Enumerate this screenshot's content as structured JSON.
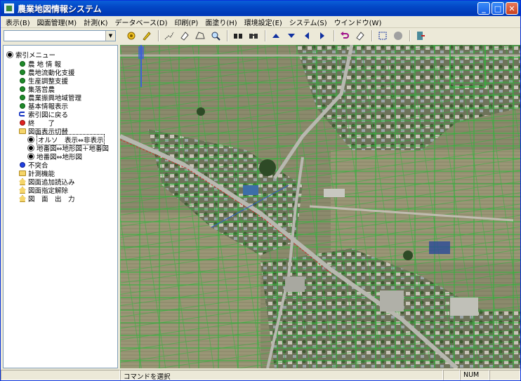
{
  "window": {
    "title": "農業地図情報システム"
  },
  "title_buttons": {
    "minimize": "_",
    "maximize": "□",
    "close": "✕"
  },
  "menu": [
    "表示(B)",
    "図面管理(M)",
    "計測(K)",
    "データベース(D)",
    "印刷(P)",
    "面塗り(H)",
    "環境設定(E)",
    "システム(S)",
    "ウインドウ(W)"
  ],
  "toolbar": {
    "combo_value": "",
    "icons": [
      "refresh-icon",
      "pen-icon",
      "line-measure-icon",
      "eraser-icon",
      "area-icon",
      "zoom-icon",
      "binocular-icon",
      "binocular2-icon",
      "up-icon",
      "down-icon",
      "left-icon",
      "right-icon",
      "undo-icon",
      "clear-icon",
      "select-icon",
      "stop-icon",
      "exit-icon"
    ]
  },
  "sidebar": {
    "root": "索引メニュー",
    "items": [
      {
        "label": "農 地 情 報",
        "icon": "green"
      },
      {
        "label": "農地流動化支援",
        "icon": "green"
      },
      {
        "label": "生産調整支援",
        "icon": "green"
      },
      {
        "label": "集落営農",
        "icon": "green"
      },
      {
        "label": "農業振興地域管理",
        "icon": "green"
      },
      {
        "label": "基本情報表示",
        "icon": "green"
      },
      {
        "label": "索引図に戻る",
        "icon": "back"
      },
      {
        "label": "終　　了",
        "icon": "red"
      },
      {
        "label": "図面表示切替",
        "icon": "folder-open"
      },
      {
        "label": "オルソ　表示⇔非表示",
        "icon": "black"
      },
      {
        "label": "地番図⇔地形図＋地番図",
        "icon": "black"
      },
      {
        "label": "地番図⇔地形図",
        "icon": "black"
      },
      {
        "label": "不突合",
        "icon": "blue"
      },
      {
        "label": "計測機能",
        "icon": "folder"
      },
      {
        "label": "図面追加読込み",
        "icon": "house"
      },
      {
        "label": "図面指定解除",
        "icon": "house"
      },
      {
        "label": "図　面　出　力",
        "icon": "house"
      }
    ]
  },
  "status": {
    "message": "コマンドを選択",
    "num": "NUM"
  },
  "colors": {
    "title_bar": "#0347c6",
    "window_bg": "#ece9d8",
    "parcel_line": "#2eb82e",
    "road": "#b8b8b0"
  }
}
